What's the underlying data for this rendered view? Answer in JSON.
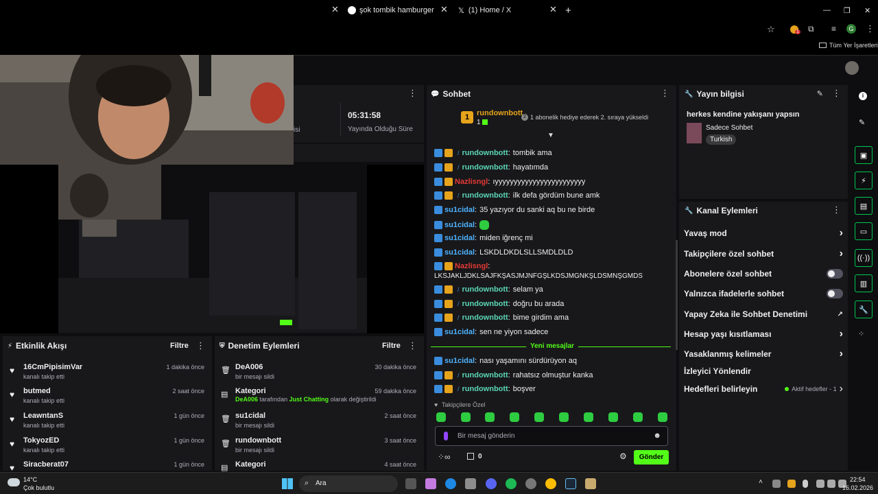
{
  "browser": {
    "tabs": [
      {
        "title": "şok tombik hamburger - Googl"
      },
      {
        "title": "(1) Home / X"
      }
    ],
    "new_tab": "+",
    "bookmarks_label": "Tüm Yer İşaretleri",
    "profile_letter": "G",
    "ext_badge": "1"
  },
  "stats": {
    "uptime_value": "05:31:58",
    "uptime_label": "Yayında Olduğu Süre",
    "viewers_label_partial": "isi"
  },
  "chat": {
    "header": "Sohbet",
    "pinned": {
      "rank": "1",
      "user": "rundownbott",
      "count": "1",
      "sub_count": "2",
      "text": "1 abonelik hediye ederek 2. sıraya yükseldi"
    },
    "messages": [
      {
        "user": "rundownbott",
        "cls": "user-green",
        "text": "tombik ama"
      },
      {
        "user": "rundownbott",
        "cls": "user-green",
        "text": "hayatımda"
      },
      {
        "user": "Nazlisngl",
        "cls": "user-red",
        "text": "ıyyyyyyyyyyyyyyyyyyyyyyyy"
      },
      {
        "user": "rundownbott",
        "cls": "user-green",
        "text": "ilk defa gördüm bune amk"
      },
      {
        "user": "su1cidal",
        "cls": "user-blue",
        "text": "35 yazıyor du sanki aq bu ne birde"
      },
      {
        "user": "su1cidal",
        "cls": "user-blue",
        "text": ""
      },
      {
        "user": "su1cidal",
        "cls": "user-blue",
        "text": "miden iğrenç mi"
      },
      {
        "user": "su1cidal",
        "cls": "user-blue",
        "text": "LSKDLDKDLSLLSMDLDLD"
      },
      {
        "user": "Nazlisngl",
        "cls": "user-red",
        "text": ""
      },
      {
        "user": "rundownbott",
        "cls": "user-green",
        "text": "selam ya"
      },
      {
        "user": "rundownbott",
        "cls": "user-green",
        "text": "doğru bu arada"
      },
      {
        "user": "rundownbott",
        "cls": "user-green",
        "text": "bime girdim ama"
      },
      {
        "user": "su1cidal",
        "cls": "user-blue",
        "text": "sen ne yiyon sadece"
      }
    ],
    "long_line": "LKSJAKLJDKLSAJFKŞASJMJNFGŞLKDSJMGNKŞLDSMNŞGMDS",
    "new_messages": "Yeni mesajlar",
    "new_msgs": [
      {
        "user": "su1cidal",
        "cls": "user-blue",
        "text": "nası yaşamını sürdürüyon aq"
      },
      {
        "user": "rundownbott",
        "cls": "user-green",
        "text": "rahatsız olmuştur kanka"
      },
      {
        "user": "rundownbott",
        "cls": "user-green",
        "text": "boşver"
      }
    ],
    "followers_only": "Takipçilere Özel",
    "input_placeholder": "Bir mesaj gönderin",
    "points": "0",
    "send": "Gönder"
  },
  "stream_info": {
    "header": "Yayın bilgisi",
    "title": "herkes kendine yakışanı yapsın",
    "category": "Sadece Sohbet",
    "language": "Turkish"
  },
  "channel_actions": {
    "header": "Kanal Eylemleri",
    "items": [
      {
        "label": "Yavaş mod",
        "ctrl": "chevron"
      },
      {
        "label": "Takipçilere özel sohbet",
        "ctrl": "chevron"
      },
      {
        "label": "Abonelere özel sohbet",
        "ctrl": "toggle"
      },
      {
        "label": "Yalnızca ifadelerle sohbet",
        "ctrl": "toggle"
      },
      {
        "label": "Yapay Zeka ile Sohbet Denetimi",
        "ctrl": "external"
      },
      {
        "label": "Hesap yaşı kısıtlaması",
        "ctrl": "chevron"
      },
      {
        "label": "Yasaklanmış kelimeler",
        "ctrl": "chevron"
      },
      {
        "label": "İzleyici Yönlendir",
        "ctrl": "none"
      },
      {
        "label": "Hedefleri belirleyin",
        "ctrl": "goal"
      }
    ],
    "goal_status": "Aktif hedefler - 1"
  },
  "activity": {
    "header": "Etkinlik Akışı",
    "filter": "Filtre",
    "items": [
      {
        "name": "16CmPipisimVar",
        "sub": "kanalı takip etti",
        "time": "1 dakika önce"
      },
      {
        "name": "butmed",
        "sub": "kanalı takip etti",
        "time": "2 saat önce"
      },
      {
        "name": "LeawntanS",
        "sub": "kanalı takip etti",
        "time": "1 gün önce"
      },
      {
        "name": "TokyozED",
        "sub": "kanalı takip etti",
        "time": "1 gün önce"
      },
      {
        "name": "Siracberat07",
        "sub": "",
        "time": "1 gün önce"
      }
    ]
  },
  "moderation": {
    "header": "Denetim Eylemleri",
    "filter": "Filtre",
    "items": [
      {
        "name": "DeA006",
        "sub": "bir mesajı sildi",
        "time": "30 dakika önce"
      },
      {
        "name": "Kategori",
        "sub": "",
        "time": "59 dakika önce"
      },
      {
        "name": "su1cidal",
        "sub": "bir mesajı sildi",
        "time": "2 saat önce"
      },
      {
        "name": "rundownbott",
        "sub": "bir mesajı sildi",
        "time": "3 saat önce"
      },
      {
        "name": "Kategori",
        "sub": "",
        "time": "4 saat önce"
      }
    ],
    "category_change": {
      "who": "DeA006",
      "mid": "tarafından",
      "cat": "Just Chatting",
      "end": "olarak değiştirildi"
    }
  },
  "taskbar": {
    "weather_temp": "14°C",
    "weather_desc": "Çok bulutlu",
    "search": "Ara",
    "time": "22:54",
    "date": "16.02.2026"
  },
  "colors": {
    "accent": "#53fc18",
    "panel": "#18181b",
    "bg": "#0e0e10"
  }
}
